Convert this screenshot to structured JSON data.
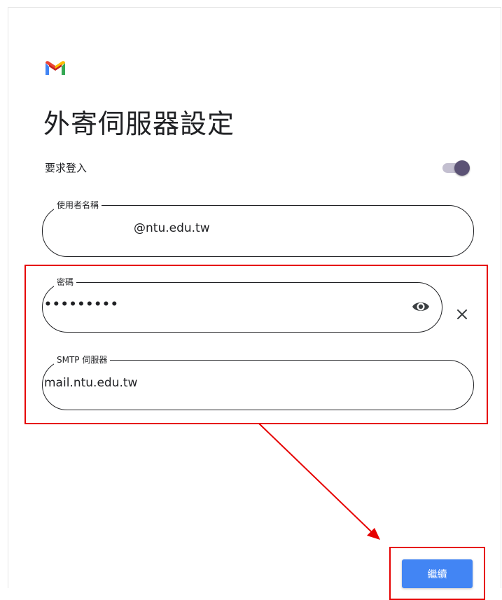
{
  "header": {
    "logo_icon": "gmail-logo-icon",
    "title": "外寄伺服器設定"
  },
  "login_required": {
    "label": "要求登入",
    "enabled": true
  },
  "fields": {
    "username": {
      "label": "使用者名稱",
      "value": "@ntu.edu.tw"
    },
    "password": {
      "label": "密碼",
      "value": "•••••••••"
    },
    "smtp": {
      "label": "SMTP 伺服器",
      "value": "mail.ntu.edu.tw"
    }
  },
  "actions": {
    "continue_label": "繼續"
  },
  "colors": {
    "accent_button": "#4285f4",
    "toggle_thumb": "#5b5275",
    "annotation": "#e60000"
  },
  "icons": [
    "gmail-logo-icon",
    "eye-icon",
    "close-icon",
    "annotation-arrow"
  ]
}
